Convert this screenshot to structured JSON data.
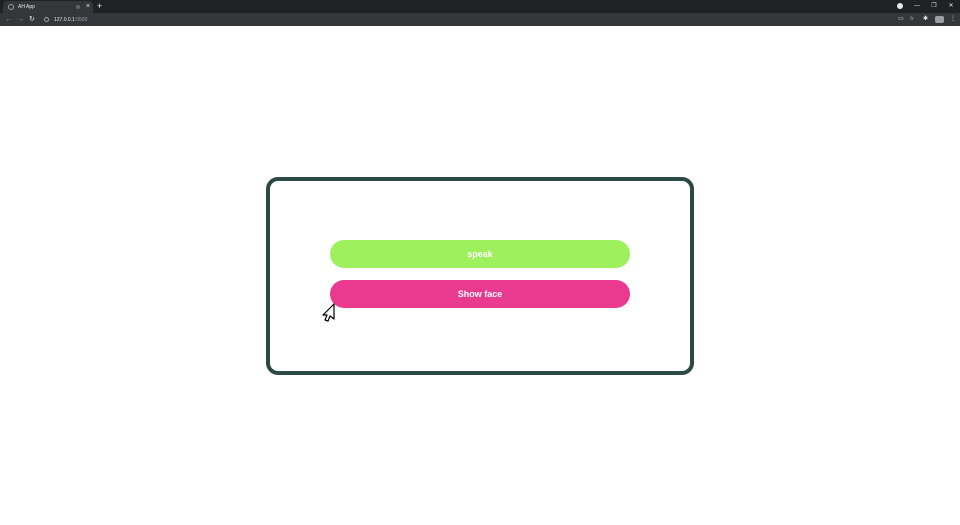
{
  "browser": {
    "tab": {
      "title": "AH App",
      "close_icon": "×"
    },
    "new_tab_icon": "+",
    "window": {
      "minimize": "—",
      "maximize": "❐",
      "close": "✕"
    },
    "nav": {
      "back": "←",
      "forward": "→",
      "reload": "↻"
    },
    "url": {
      "host": "127.0.0.1",
      "port": ":5500"
    },
    "toolbar_icons": {
      "cast": "▭",
      "bookmark": "☆",
      "extensions": "✱",
      "menu": "⋮"
    }
  },
  "main": {
    "buttons": {
      "speak_label": "speak",
      "show_face_label": "Show face"
    }
  },
  "colors": {
    "card_border": "#2c4a45",
    "speak_button": "#9ef05d",
    "show_face_button": "#ea3a8f",
    "button_text": "#ffffff"
  }
}
